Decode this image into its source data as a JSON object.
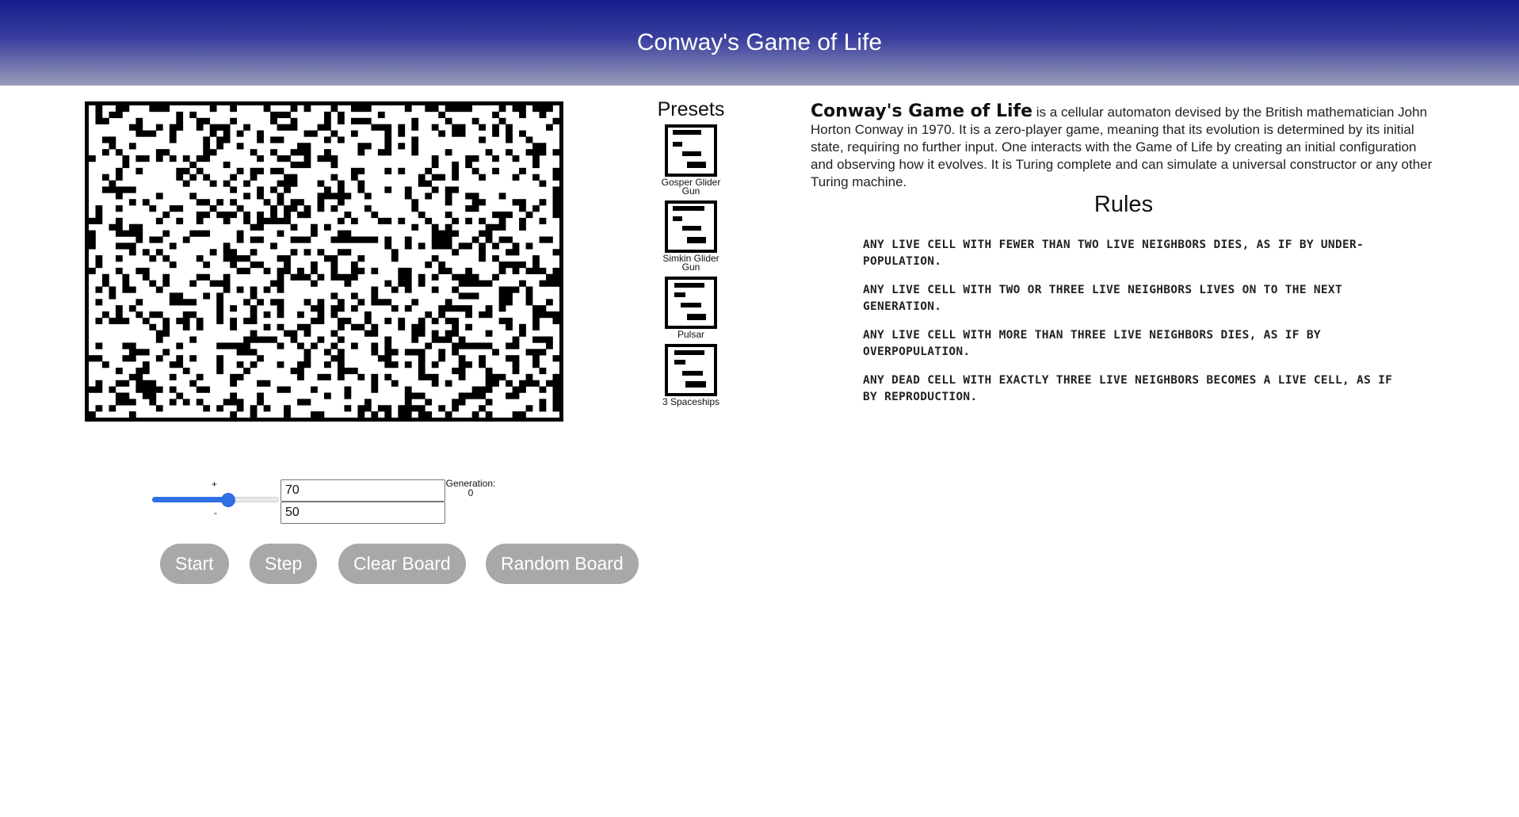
{
  "header": {
    "title": "Conway's Game of Life"
  },
  "board": {
    "cols": 70,
    "rows": 50,
    "live_color": "#000000",
    "dead_color": "#ffffff",
    "live_fraction": 0.3
  },
  "presets": {
    "title": "Presets",
    "items": [
      {
        "label": "Gosper Glider Gun",
        "icon": "preset-thumbnail"
      },
      {
        "label": "Simkin Glider Gun",
        "icon": "preset-thumbnail"
      },
      {
        "label": "Pulsar",
        "icon": "preset-thumbnail"
      },
      {
        "label": "3 Spaceships",
        "icon": "preset-thumbnail"
      }
    ]
  },
  "description": {
    "lead": "Conway's Game of Life",
    "text": " is a cellular automaton devised by the British mathematician John Horton Conway in 1970. It is a zero-player game, meaning that its evolution is determined by its initial state, requiring no further input. One interacts with the Game of Life by creating an initial configuration and observing how it evolves. It is Turing complete and can simulate a universal constructor or any other Turing machine."
  },
  "rules": {
    "title": "Rules",
    "items": [
      "Any live cell with fewer than two live neighbors dies, as if by under-population.",
      "Any live cell with two or three live neighbors lives on to the next generation.",
      "Any live cell with more than three live neighbors dies, as if by overpopulation.",
      "Any dead cell with exactly three live neighbors becomes a live cell, as if by reproduction."
    ]
  },
  "controls": {
    "speed_plus": "+",
    "speed_minus": "-",
    "speed_value": 0.6,
    "accent_color": "#2f6fe4",
    "cols_value": "70",
    "rows_value": "50",
    "generation_label": "Generation:",
    "generation_value": "0"
  },
  "buttons": {
    "start": "Start",
    "step": "Step",
    "clear": "Clear Board",
    "random": "Random Board",
    "color": "#a8a8a8"
  }
}
